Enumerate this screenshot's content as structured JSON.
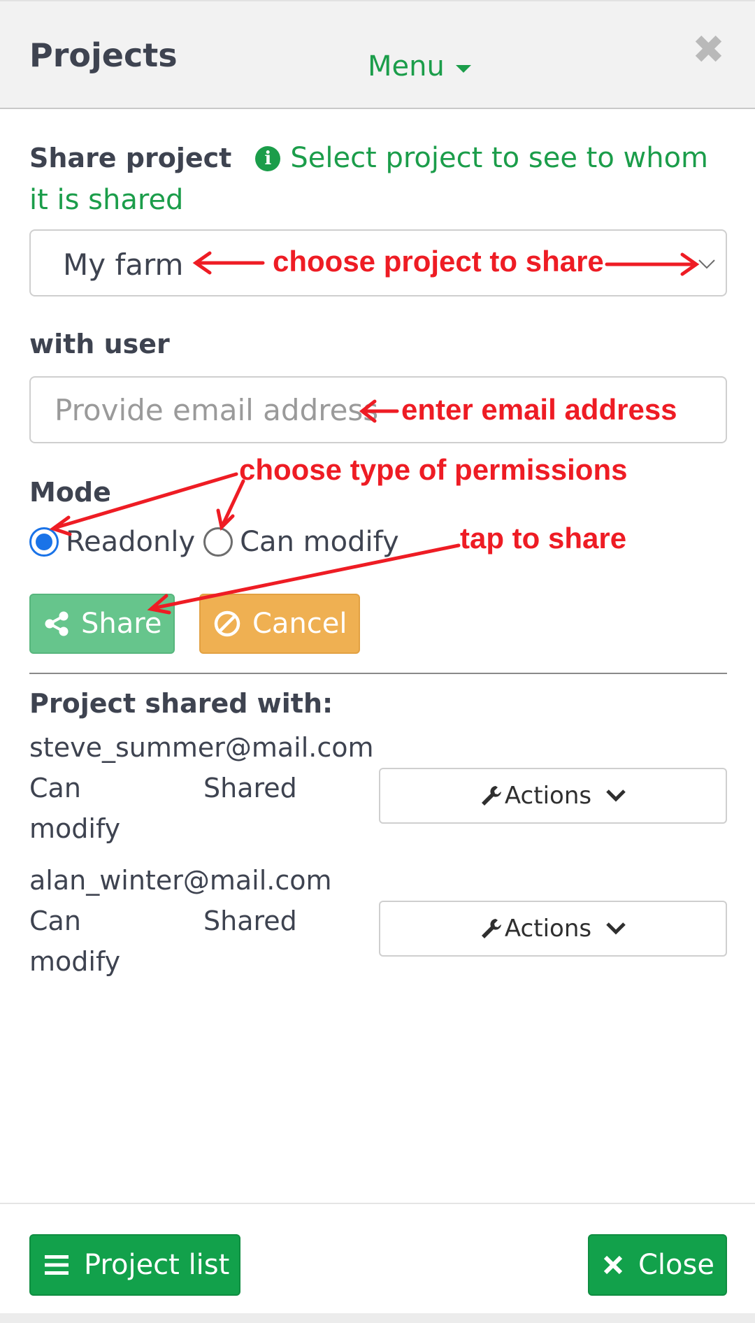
{
  "header": {
    "title": "Projects",
    "menu_label": "Menu",
    "close_glyph": "✖"
  },
  "share": {
    "label": "Share project",
    "hint": "Select project to see to whom it is shared",
    "project_selected": "My farm",
    "user_label": "with user",
    "email_placeholder": "Provide email address",
    "mode_label": "Mode",
    "mode_options": [
      "Readonly",
      "Can modify"
    ],
    "mode_selected": "Readonly",
    "share_button": "Share",
    "cancel_button": "Cancel"
  },
  "shared_with": {
    "label": "Project shared with:",
    "entries": [
      {
        "email": "steve_summer@mail.com",
        "permission": "Can modify",
        "status": "Shared",
        "actions_label": "Actions"
      },
      {
        "email": "alan_winter@mail.com",
        "permission": "Can modify",
        "status": "Shared",
        "actions_label": "Actions"
      }
    ]
  },
  "footer": {
    "project_list_button": "Project list",
    "close_button": "Close"
  },
  "annotations": {
    "choose_project": "choose project to share",
    "enter_email": "enter email address",
    "choose_permissions": "choose type of permissions",
    "tap_to_share": "tap to share"
  },
  "colors": {
    "brand_green": "#12a14b",
    "share_green": "#66c58c",
    "cancel_orange": "#efb052",
    "annotation_red": "#ee1c24",
    "radio_blue": "#1a73e8"
  },
  "icons": {
    "menu": "caret-down-icon",
    "close": "close-icon",
    "info": "info-icon",
    "select": "chevron-down-icon",
    "share": "share-icon",
    "cancel": "ban-icon",
    "actions": "wrench-icon",
    "list": "bars-icon"
  }
}
